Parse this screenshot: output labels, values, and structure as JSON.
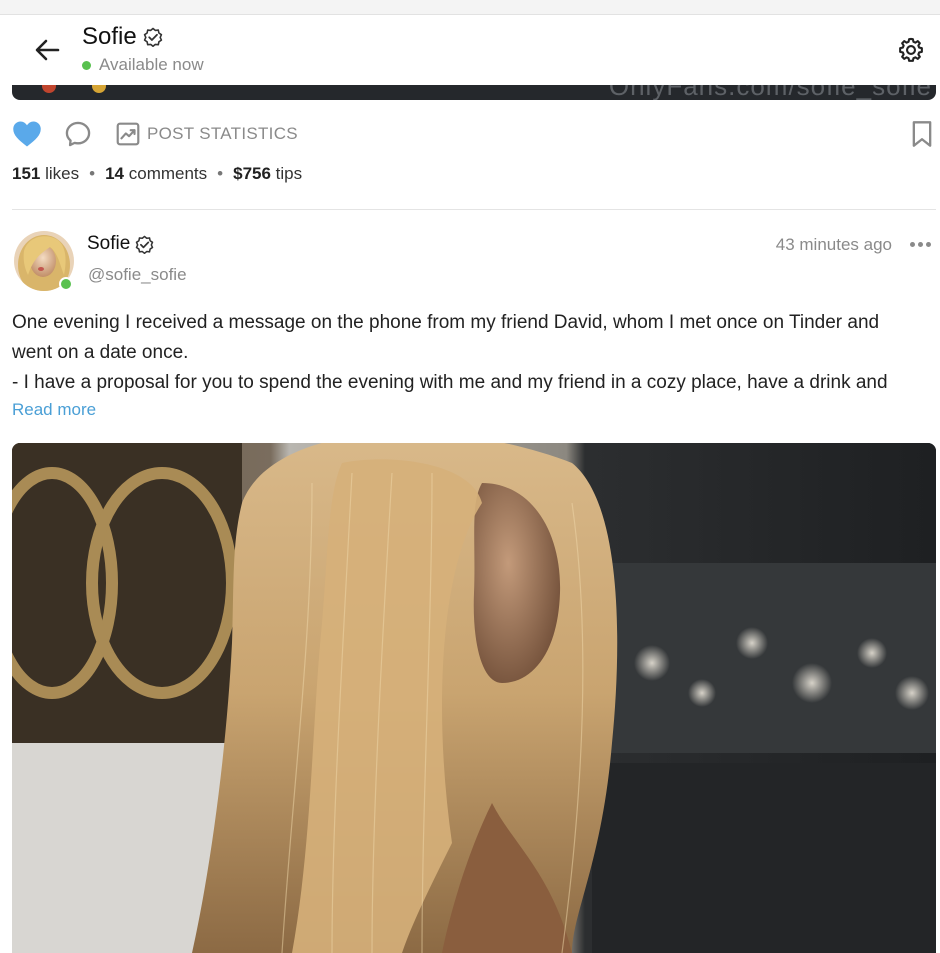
{
  "header": {
    "name": "Sofie",
    "status": "Available now"
  },
  "previous_post": {
    "watermark": "OnlyFans.com/sofie_sofie"
  },
  "actions": {
    "post_statistics_label": "POST STATISTICS"
  },
  "counts": {
    "likes_count": "151",
    "likes_label": "likes",
    "comments_count": "14",
    "comments_label": "comments",
    "tips_amount": "$756",
    "tips_label": "tips"
  },
  "post": {
    "author_name": "Sofie",
    "author_handle": "@sofie_sofie",
    "time": "43 minutes ago",
    "text_lines": [
      "One evening I received a message on the phone from my friend David, whom I met once on Tinder and",
      "went on a date once.",
      "- I have a proposal for you to spend the evening with me and my friend in a cozy place, have a drink and"
    ],
    "read_more_label": "Read more"
  },
  "colors": {
    "accent_blue": "#4a9fd6",
    "like_blue": "#5aa9ea",
    "online_green": "#59c14f"
  },
  "icons": [
    "arrow-left-icon",
    "verified-badge-icon",
    "gear-icon",
    "heart-icon",
    "comment-icon",
    "stats-chart-icon",
    "bookmark-icon",
    "more-dots-icon"
  ]
}
